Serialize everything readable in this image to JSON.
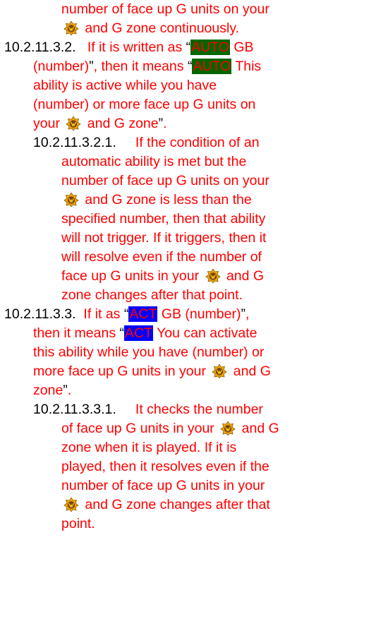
{
  "icon_name": "vanguard-circle-icon",
  "badge_colors": {
    "auto_bg": "#006600",
    "act_bg": "#0000ff",
    "text": "#ff0000"
  },
  "l1": {
    "t": "number of face up G units on your"
  },
  "l2": {
    "t": "and G zone continuously."
  },
  "l3": {
    "num": "10.2.11.3.2.",
    "a": "If it is written as",
    "q1": "“",
    "badge": "AUTO",
    "b": "GB"
  },
  "l4": {
    "a": "(number)",
    "q1": "”",
    "b": ", then it means",
    "q2": "“",
    "badge": "AUTO",
    "c": "This"
  },
  "l5": {
    "t": "ability is active while you have"
  },
  "l6": {
    "t": "(number) or more face up G units on"
  },
  "l7": {
    "a": "your",
    "b": "and G zone",
    "q": "”",
    "c": "."
  },
  "l8": {
    "num": "10.2.11.3.2.1.",
    "t": "If the condition of an"
  },
  "l9": {
    "t": "automatic ability is met but the"
  },
  "l10": {
    "t": "number of face up G units on your"
  },
  "l11": {
    "t": "and G zone is less than the"
  },
  "l12": {
    "t": "specified number, then that ability"
  },
  "l13": {
    "t": "will not trigger. If it triggers, then it"
  },
  "l14": {
    "t": "will resolve even if the number of"
  },
  "l15": {
    "a": "face up G units in your",
    "b": "and G"
  },
  "l16": {
    "t": "zone changes after that point."
  },
  "l17": {
    "num": "10.2.11.3.3.",
    "a": "If it as",
    "q1": "“",
    "badge": "ACT",
    "b": "GB (number)",
    "q2": "”",
    "c": ","
  },
  "l18": {
    "a": "then it means",
    "q1": "“",
    "badge": "ACT",
    "b": "You can activate"
  },
  "l19": {
    "t": "this ability while you have (number) or"
  },
  "l20": {
    "a": "more face up G units in your",
    "b": "and G"
  },
  "l21": {
    "a": "zone",
    "q": "”",
    "c": "."
  },
  "l22": {
    "num": "10.2.11.3.3.1.",
    "t": "It checks the number"
  },
  "l23": {
    "a": "of face up G units in your",
    "b": "and G"
  },
  "l24": {
    "t": "zone when it is played. If it is"
  },
  "l25": {
    "t": "played, then it resolves even if the"
  },
  "l26": {
    "t": "number of face up G units in your"
  },
  "l27": {
    "t": "and G zone changes after that"
  },
  "l28": {
    "t": "point."
  }
}
